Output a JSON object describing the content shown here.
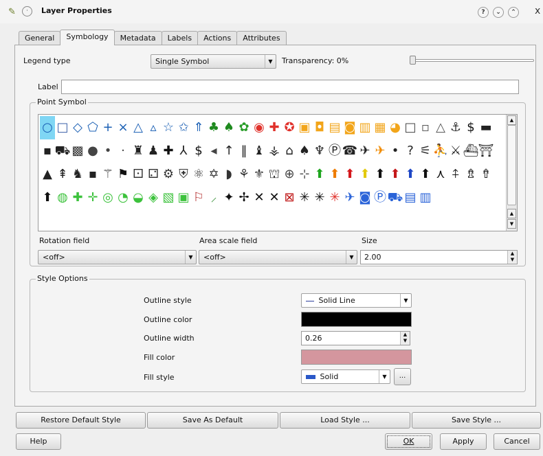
{
  "window": {
    "title": "Layer Properties",
    "help_button": "?",
    "minimize_button": "⌄",
    "maximize_button": "⌃",
    "close_button": "x"
  },
  "tabs": [
    "General",
    "Symbology",
    "Metadata",
    "Labels",
    "Actions",
    "Attributes"
  ],
  "active_tab": "Symbology",
  "legend": {
    "label": "Legend type",
    "value": "Single Symbol",
    "transparency_label": "Transparency: 0%",
    "transparency_value": 0
  },
  "label_field": {
    "label": "Label",
    "value": ""
  },
  "point_symbol": {
    "title": "Point Symbol",
    "selected_index": 0,
    "symbols": [
      {
        "g": "○",
        "c": "#1a5fb4"
      },
      {
        "g": "□",
        "c": "#3a5fa8"
      },
      {
        "g": "◇",
        "c": "#1a5fb4"
      },
      {
        "g": "⬠",
        "c": "#1a5fb4"
      },
      {
        "g": "+",
        "c": "#1a5fb4"
      },
      {
        "g": "×",
        "c": "#1a5fb4"
      },
      {
        "g": "△",
        "c": "#1a5fb4"
      },
      {
        "g": "▵",
        "c": "#1a5fb4"
      },
      {
        "g": "☆",
        "c": "#1a5fb4"
      },
      {
        "g": "✩",
        "c": "#1a5fb4"
      },
      {
        "g": "⇑",
        "c": "#1a5fb4"
      },
      {
        "g": "♣",
        "c": "#1f8a1f"
      },
      {
        "g": "♠",
        "c": "#1f8a1f"
      },
      {
        "g": "✿",
        "c": "#2a9d2a"
      },
      {
        "g": "◉",
        "c": "#e0312b"
      },
      {
        "g": "✚",
        "c": "#e0312b"
      },
      {
        "g": "✪",
        "c": "#e0312b"
      },
      {
        "g": "▣",
        "c": "#f2a51a"
      },
      {
        "g": "◘",
        "c": "#f2a51a"
      },
      {
        "g": "▤",
        "c": "#f2a51a"
      },
      {
        "g": "◙",
        "c": "#f2a51a"
      },
      {
        "g": "▥",
        "c": "#f2a51a"
      },
      {
        "g": "▦",
        "c": "#f2a51a"
      },
      {
        "g": "◕",
        "c": "#f2a51a"
      },
      {
        "g": "□",
        "c": "#444"
      },
      {
        "g": "▫",
        "c": "#555"
      },
      {
        "g": "△",
        "c": "#555"
      },
      {
        "g": "⚓",
        "c": "#333"
      },
      {
        "g": "$",
        "c": "#111"
      },
      {
        "g": "▬",
        "c": "#222"
      },
      {
        "g": "▪",
        "c": "#222"
      },
      {
        "g": "⛟",
        "c": "#222"
      },
      {
        "g": "▩",
        "c": "#333"
      },
      {
        "g": "●",
        "c": "#444"
      },
      {
        "g": "•",
        "c": "#444"
      },
      {
        "g": "·",
        "c": "#444"
      },
      {
        "g": "♜",
        "c": "#222"
      },
      {
        "g": "♟",
        "c": "#222"
      },
      {
        "g": "✚",
        "c": "#111"
      },
      {
        "g": "⅄",
        "c": "#222"
      },
      {
        "g": "$",
        "c": "#111"
      },
      {
        "g": "◂",
        "c": "#444"
      },
      {
        "g": "↑",
        "c": "#222"
      },
      {
        "g": "‖",
        "c": "#222"
      },
      {
        "g": "♝",
        "c": "#222"
      },
      {
        "g": "⚶",
        "c": "#222"
      },
      {
        "g": "⌂",
        "c": "#222"
      },
      {
        "g": "♠",
        "c": "#222"
      },
      {
        "g": "♆",
        "c": "#222"
      },
      {
        "g": "Ⓟ",
        "c": "#222"
      },
      {
        "g": "☎",
        "c": "#222"
      },
      {
        "g": "✈",
        "c": "#222"
      },
      {
        "g": "✈",
        "c": "#f08a00"
      },
      {
        "g": "•",
        "c": "#222"
      },
      {
        "g": "?",
        "c": "#222"
      },
      {
        "g": "⚟",
        "c": "#333"
      },
      {
        "g": "⛹",
        "c": "#222"
      },
      {
        "g": "⚔",
        "c": "#222"
      },
      {
        "g": "⛴",
        "c": "#222"
      },
      {
        "g": "⛩",
        "c": "#222"
      },
      {
        "g": "▲",
        "c": "#222"
      },
      {
        "g": "⇞",
        "c": "#222"
      },
      {
        "g": "♞",
        "c": "#222"
      },
      {
        "g": "▪",
        "c": "#222"
      },
      {
        "g": "⚚",
        "c": "#222"
      },
      {
        "g": "⚑",
        "c": "#111"
      },
      {
        "g": "⚀",
        "c": "#333"
      },
      {
        "g": "⚁",
        "c": "#333"
      },
      {
        "g": "⚙",
        "c": "#333"
      },
      {
        "g": "⛨",
        "c": "#333"
      },
      {
        "g": "⚛",
        "c": "#333"
      },
      {
        "g": "✡",
        "c": "#333"
      },
      {
        "g": "◗",
        "c": "#333"
      },
      {
        "g": "⚘",
        "c": "#333"
      },
      {
        "g": "⚜",
        "c": "#333"
      },
      {
        "g": "⛫",
        "c": "#333"
      },
      {
        "g": "⊕",
        "c": "#444"
      },
      {
        "g": "⊹",
        "c": "#555"
      },
      {
        "g": "⬆",
        "c": "#1ea51e"
      },
      {
        "g": "⬆",
        "c": "#ee7c00"
      },
      {
        "g": "⬆",
        "c": "#d4181d"
      },
      {
        "g": "⬆",
        "c": "#e2c90d"
      },
      {
        "g": "⬆",
        "c": "#111"
      },
      {
        "g": "⬆",
        "c": "#c4181a"
      },
      {
        "g": "⬆",
        "c": "#1e47c5"
      },
      {
        "g": "⬆",
        "c": "#111"
      },
      {
        "g": "⋏",
        "c": "#111"
      },
      {
        "g": "⍏",
        "c": "#111"
      },
      {
        "g": "⇯",
        "c": "#111"
      },
      {
        "g": "⇮",
        "c": "#111"
      },
      {
        "g": "⬆",
        "c": "#111"
      },
      {
        "g": "◍",
        "c": "#3cc23c"
      },
      {
        "g": "✚",
        "c": "#3cc23c"
      },
      {
        "g": "✛",
        "c": "#3cc23c"
      },
      {
        "g": "◎",
        "c": "#3cc23c"
      },
      {
        "g": "◔",
        "c": "#3cc23c"
      },
      {
        "g": "◒",
        "c": "#3cc23c"
      },
      {
        "g": "◈",
        "c": "#3cc23c"
      },
      {
        "g": "▧",
        "c": "#3cc23c"
      },
      {
        "g": "▣",
        "c": "#3cc23c"
      },
      {
        "g": "⚐",
        "c": "#b32a2a"
      },
      {
        "g": "⸝",
        "c": "#4a9a4a"
      },
      {
        "g": "✦",
        "c": "#111"
      },
      {
        "g": "✢",
        "c": "#111"
      },
      {
        "g": "✕",
        "c": "#111"
      },
      {
        "g": "✕",
        "c": "#111"
      },
      {
        "g": "⊠",
        "c": "#c01818"
      },
      {
        "g": "✳",
        "c": "#111"
      },
      {
        "g": "✳",
        "c": "#111"
      },
      {
        "g": "✳",
        "c": "#e0312b"
      },
      {
        "g": "✈",
        "c": "#2a63d8"
      },
      {
        "g": "◙",
        "c": "#2a63d8"
      },
      {
        "g": "Ⓟ",
        "c": "#2a63d8"
      },
      {
        "g": "⛟",
        "c": "#2a63d8"
      },
      {
        "g": "▤",
        "c": "#2a63d8"
      },
      {
        "g": "▥",
        "c": "#2a63d8"
      }
    ]
  },
  "fields": {
    "rotation_label": "Rotation field",
    "rotation_value": "<off>",
    "area_label": "Area scale field",
    "area_value": "<off>",
    "size_label": "Size",
    "size_value": "2.00"
  },
  "style_options": {
    "title": "Style Options",
    "outline_style_label": "Outline style",
    "outline_style_value": "Solid Line",
    "outline_color_label": "Outline color",
    "outline_color": "#000000",
    "outline_width_label": "Outline width",
    "outline_width_value": "0.26",
    "fill_color_label": "Fill color",
    "fill_color": "#d4969e",
    "fill_style_label": "Fill style",
    "fill_style_value": "Solid",
    "fill_style_more": "..."
  },
  "style_buttons": [
    "Restore Default Style",
    "Save As Default",
    "Load Style ...",
    "Save Style ..."
  ],
  "bottom_buttons": {
    "help": "Help",
    "ok": "OK",
    "apply": "Apply",
    "cancel": "Cancel"
  },
  "colors": {
    "selection": "#7fd6f4",
    "outline": "#000000",
    "fill": "#d4969e"
  }
}
